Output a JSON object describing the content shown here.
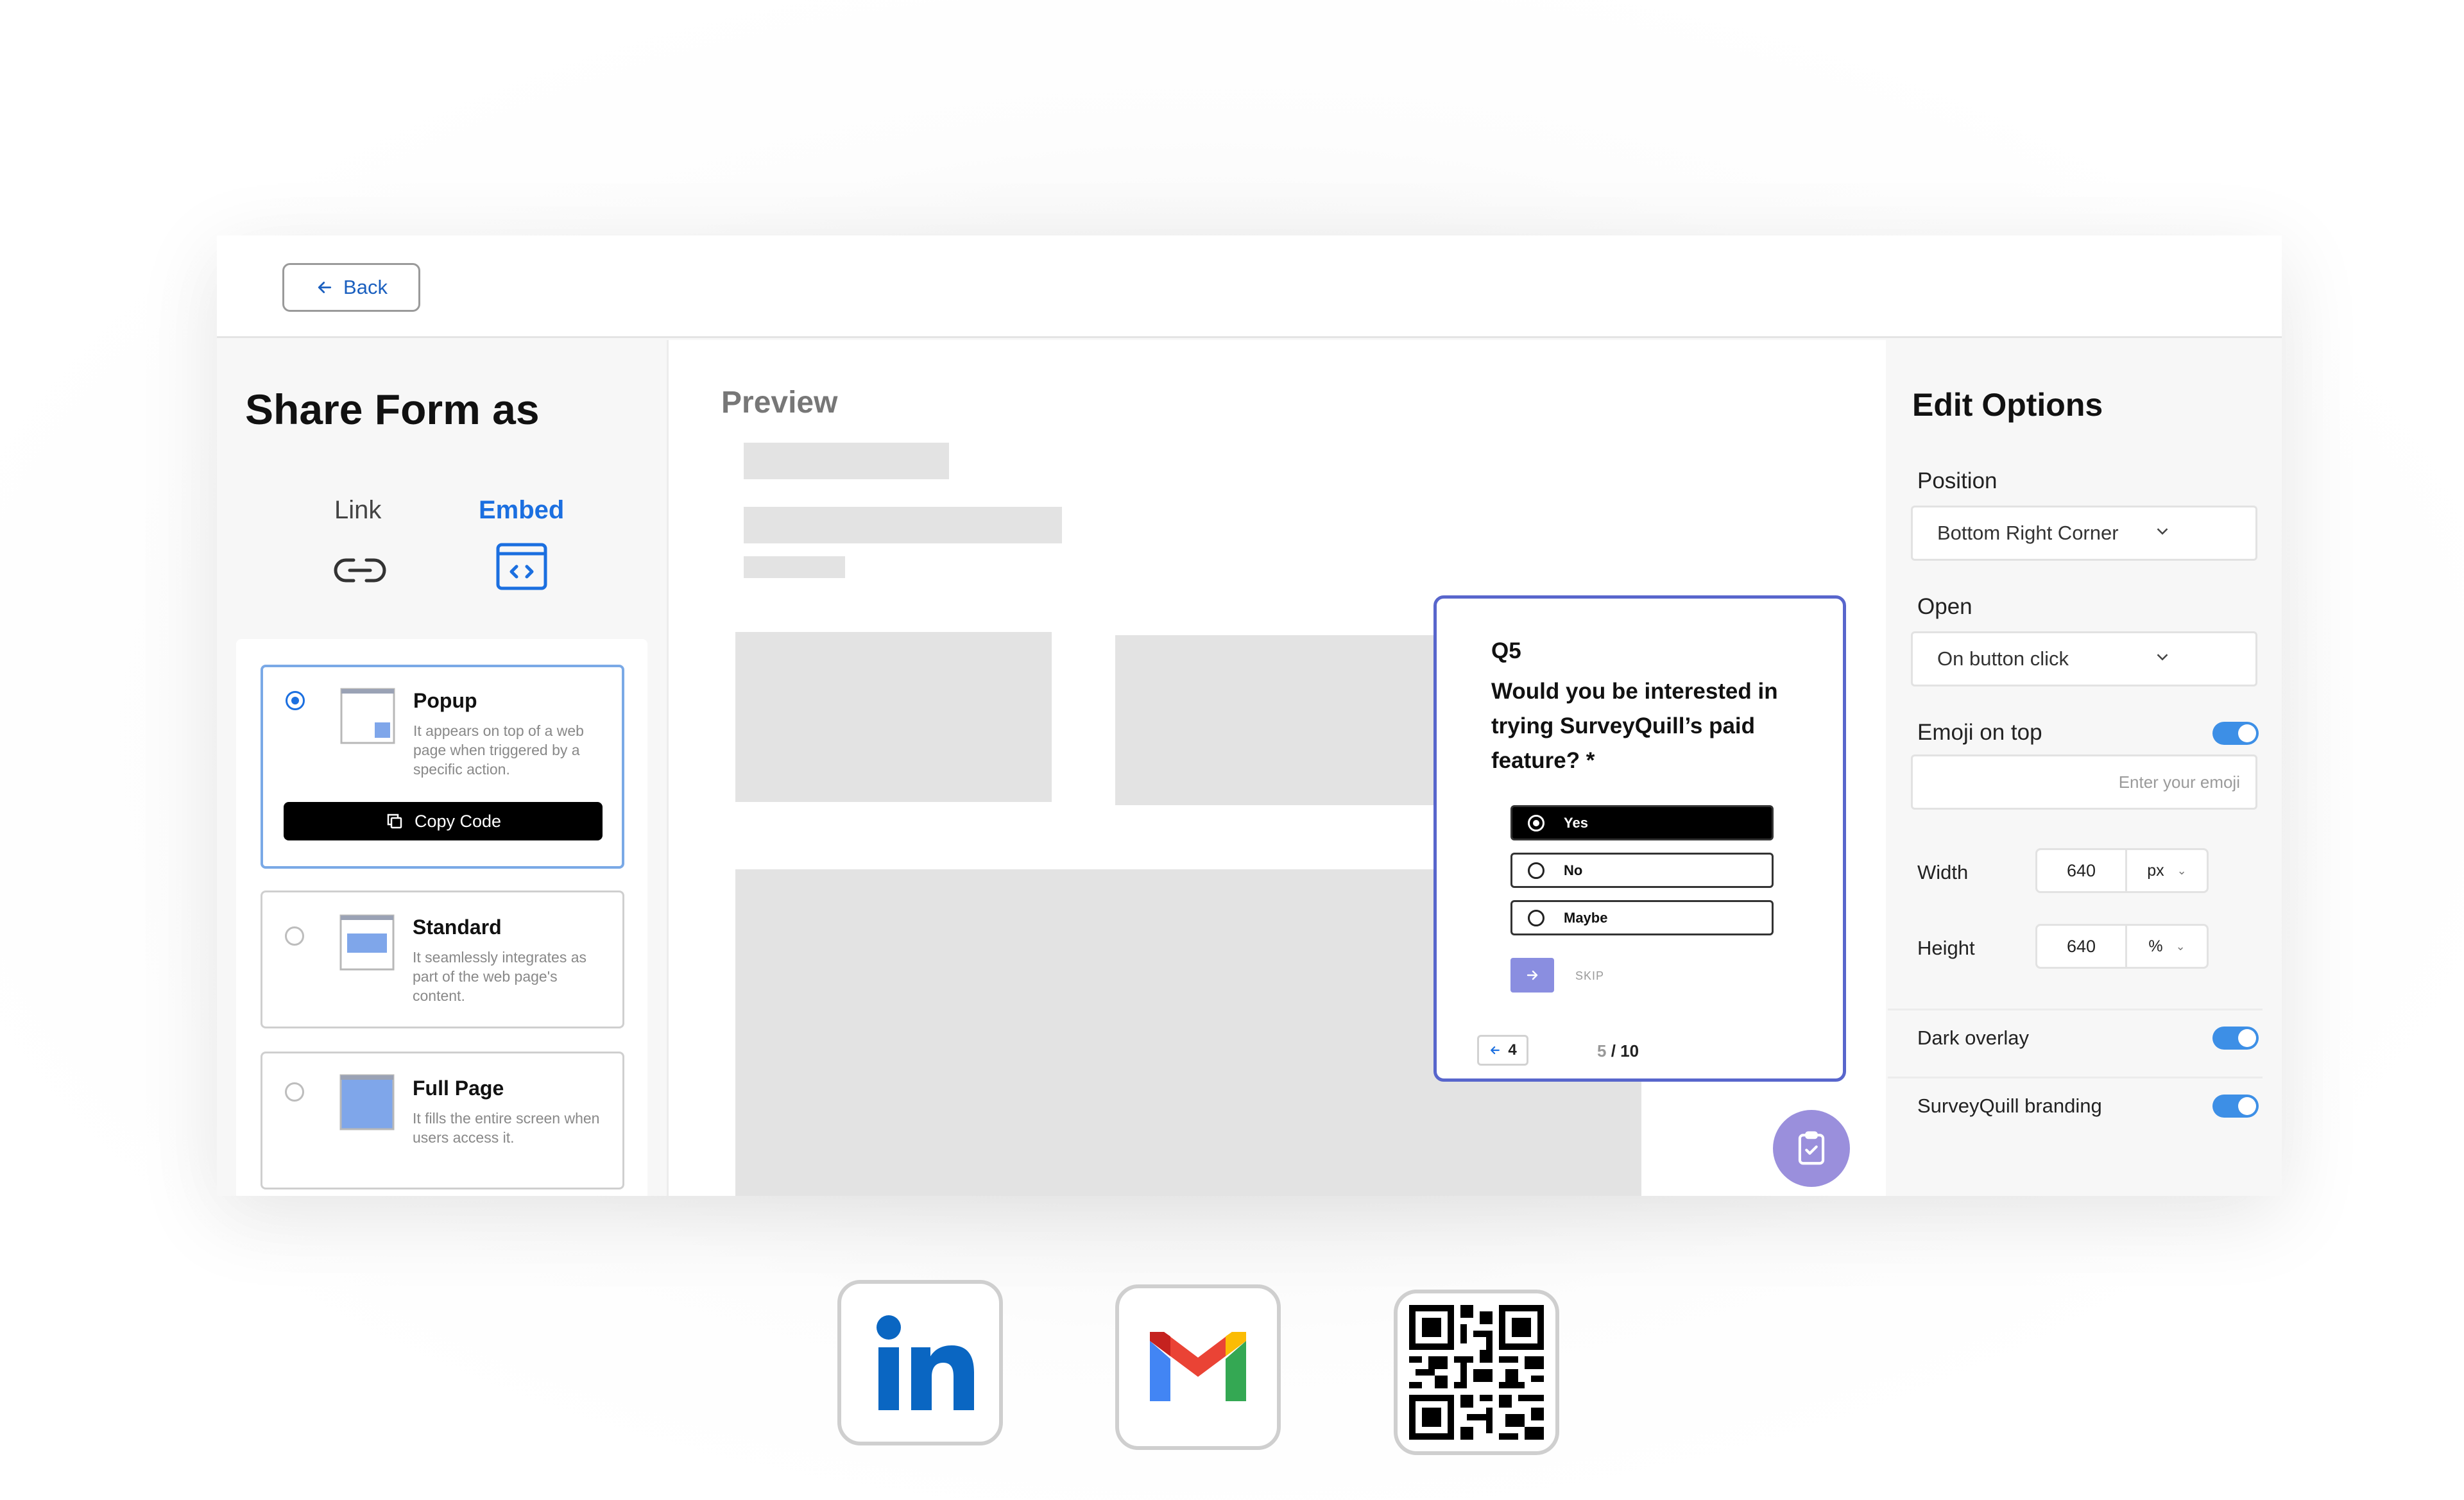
{
  "topbar": {
    "back_label": "Back"
  },
  "left": {
    "title": "Share Form as",
    "tabs": [
      {
        "label": "Link",
        "icon": "link-icon"
      },
      {
        "label": "Embed",
        "icon": "code-icon",
        "active": true
      }
    ],
    "options": [
      {
        "title": "Popup",
        "desc": "It appears on top of a web page when triggered by a specific action.",
        "selected": true,
        "button": "Copy Code"
      },
      {
        "title": "Standard",
        "desc": "It seamlessly integrates as part of the web page's content.",
        "selected": false
      },
      {
        "title": "Full Page",
        "desc": "It fills the entire screen when users access it.",
        "selected": false
      }
    ]
  },
  "preview": {
    "title": "Preview",
    "popup": {
      "qnum": "Q5",
      "question": "Would you be interested in trying SurveyQuill’s paid feature? *",
      "choices": [
        "Yes",
        "No",
        "Maybe"
      ],
      "selected_choice": "Yes",
      "skip": "SKIP",
      "prev_number": "4",
      "progress_current": "5",
      "progress_total": "/ 10"
    }
  },
  "right": {
    "title": "Edit Options",
    "position_label": "Position",
    "position_value": "Bottom Right Corner",
    "open_label": "Open",
    "open_value": "On button click",
    "emoji_label": "Emoji on top",
    "emoji_placeholder": "Enter your emoji",
    "emoji_enabled": true,
    "width_label": "Width",
    "width_value": "640",
    "width_unit": "px",
    "height_label": "Height",
    "height_value": "640",
    "height_unit": "%",
    "dark_overlay_label": "Dark overlay",
    "dark_overlay_enabled": true,
    "branding_label": "SurveyQuill branding",
    "branding_enabled": true
  },
  "share_targets": [
    "linkedin-icon",
    "gmail-icon",
    "qr-code-icon"
  ],
  "colors": {
    "accent": "#1b6fe0",
    "popup_border": "#5866cc",
    "fab": "#9a8fdc",
    "toggle": "#3d8fe6"
  }
}
